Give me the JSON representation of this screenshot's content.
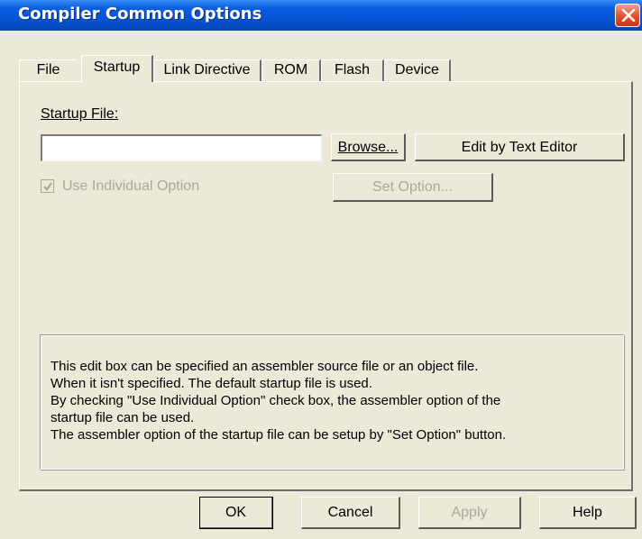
{
  "window": {
    "title": "Compiler Common Options"
  },
  "tabs": [
    {
      "label": "File",
      "selected": false
    },
    {
      "label": "Startup",
      "selected": true
    },
    {
      "label": "Link Directive",
      "selected": false
    },
    {
      "label": "ROM",
      "selected": false
    },
    {
      "label": "Flash",
      "selected": false
    },
    {
      "label": "Device",
      "selected": false
    }
  ],
  "startup": {
    "startup_file_label": "Startup File:",
    "startup_file_value": "",
    "browse_label": "Browse...",
    "edit_label": "Edit by Text Editor",
    "use_individual_label": "Use Individual Option",
    "use_individual_checked": true,
    "use_individual_enabled": false,
    "set_option_label": "Set Option...",
    "set_option_enabled": false
  },
  "info": {
    "lines": [
      "This edit box can be specified an assembler source file or an object file.",
      "When it isn't specified. The default startup file is used.",
      "By checking \"Use Individual Option\" check box, the assembler option of the",
      "startup file can be used.",
      "The assembler option of the startup file can be setup by \"Set Option\" button."
    ]
  },
  "footer": {
    "ok_label": "OK",
    "cancel_label": "Cancel",
    "apply_label": "Apply",
    "apply_enabled": false,
    "help_label": "Help"
  },
  "icons": {
    "close": "close-icon",
    "checkmark": "checkmark-icon"
  }
}
